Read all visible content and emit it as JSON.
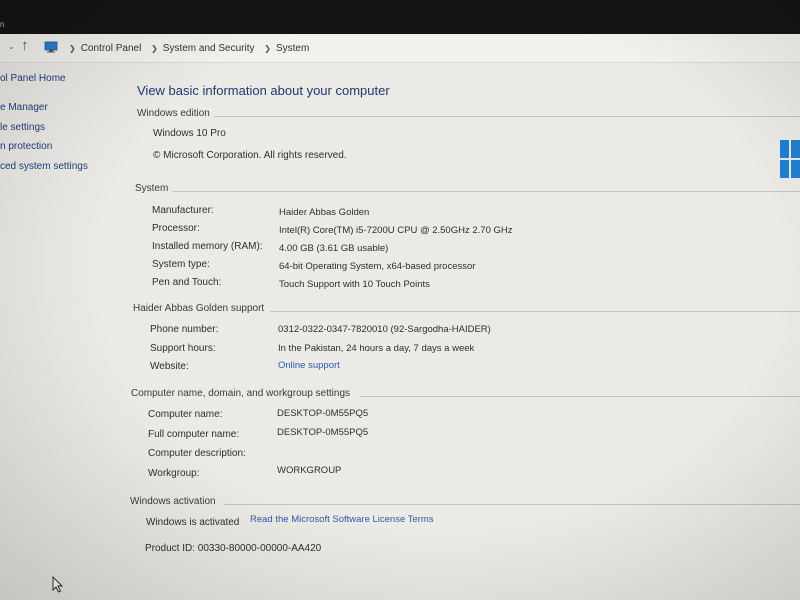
{
  "topbar": {
    "fragment": "n"
  },
  "address": {
    "crumbs": [
      "Control Panel",
      "System and Security",
      "System"
    ]
  },
  "sidebar": {
    "items": [
      {
        "label": "ol Panel Home"
      },
      {
        "label": "e Manager"
      },
      {
        "label": "le settings"
      },
      {
        "label": "n protection"
      },
      {
        "label": "ced system settings"
      }
    ]
  },
  "main": {
    "title": "View basic information about your computer",
    "windows_edition": {
      "heading": "Windows edition",
      "edition": "Windows 10 Pro",
      "copyright": "© Microsoft Corporation. All rights reserved."
    },
    "system": {
      "heading": "System",
      "rows": [
        {
          "label": "Manufacturer:",
          "value": "Haider Abbas Golden"
        },
        {
          "label": "Processor:",
          "value": "Intel(R) Core(TM) i5-7200U CPU @ 2.50GHz   2.70 GHz"
        },
        {
          "label": "Installed memory (RAM):",
          "value": "4.00 GB (3.61 GB usable)"
        },
        {
          "label": "System type:",
          "value": "64-bit Operating System, x64-based processor"
        },
        {
          "label": "Pen and Touch:",
          "value": "Touch Support with 10 Touch Points"
        }
      ]
    },
    "support": {
      "heading": "Haider Abbas Golden support",
      "rows": [
        {
          "label": "Phone number:",
          "value": "0312-0322-0347-7820010 (92-Sargodha-HAIDER)"
        },
        {
          "label": "Support hours:",
          "value": "In the Pakistan, 24 hours a day, 7 days a week"
        },
        {
          "label": "Website:",
          "value": "Online support"
        }
      ]
    },
    "computer_name": {
      "heading": "Computer name, domain, and workgroup settings",
      "rows": [
        {
          "label": "Computer name:",
          "value": "DESKTOP-0M55PQ5"
        },
        {
          "label": "Full computer name:",
          "value": "DESKTOP-0M55PQ5"
        },
        {
          "label": "Computer description:",
          "value": ""
        },
        {
          "label": "Workgroup:",
          "value": "WORKGROUP"
        }
      ]
    },
    "activation": {
      "heading": "Windows activation",
      "status": "Windows is activated",
      "license_link": "Read the Microsoft Software License Terms",
      "product_id": "Product ID:  00330-80000-00000-AA420"
    }
  },
  "colors": {
    "link": "#2a5ca8",
    "title": "#1f3a70",
    "windows_logo": "#1f7fd0",
    "topbar": "#151515"
  }
}
